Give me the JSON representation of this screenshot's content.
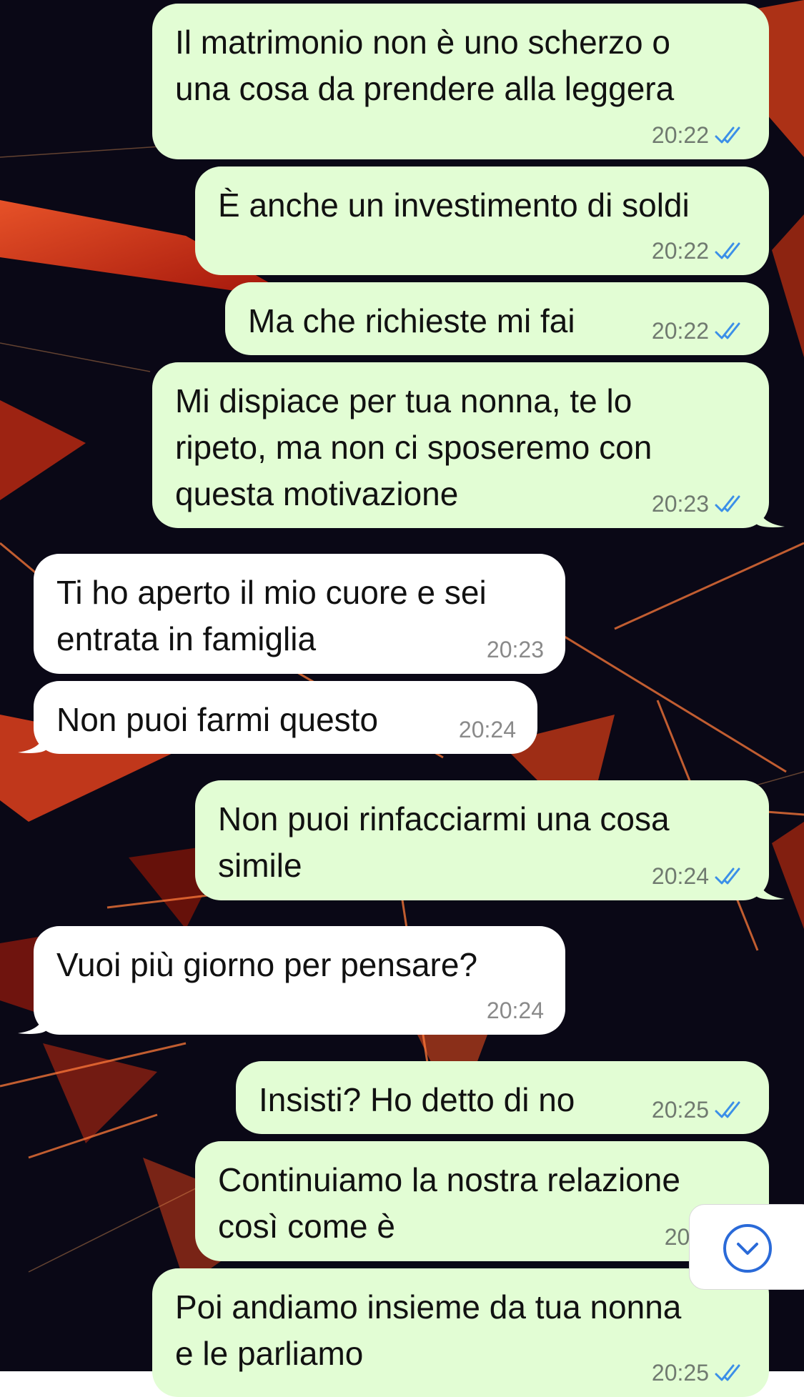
{
  "chat": {
    "messages": [
      {
        "dir": "out",
        "text": "Il matrimonio non è uno scherzo o\nuna cosa da prendere alla leggera",
        "time": "20:22",
        "status": "read"
      },
      {
        "dir": "out",
        "text": "È anche un investimento di soldi",
        "time": "20:22",
        "status": "read"
      },
      {
        "dir": "out",
        "text": "Ma che richieste mi fai",
        "time": "20:22",
        "status": "read"
      },
      {
        "dir": "out",
        "text": "Mi dispiace per tua nonna, te lo\nripeto, ma non ci sposeremo con\nquesta motivazione",
        "time": "20:23",
        "status": "read"
      },
      {
        "dir": "in",
        "text": "Ti ho aperto il mio cuore e sei\nentrata in famiglia",
        "time": "20:23"
      },
      {
        "dir": "in",
        "text": "Non puoi farmi questo",
        "time": "20:24"
      },
      {
        "dir": "out",
        "text": "Non puoi rinfacciarmi una cosa\nsimile",
        "time": "20:24",
        "status": "read"
      },
      {
        "dir": "in",
        "text": "Vuoi più giorno per pensare?",
        "time": "20:24"
      },
      {
        "dir": "out",
        "text": "Insisti? Ho detto di no",
        "time": "20:25",
        "status": "read"
      },
      {
        "dir": "out",
        "text": "Continuiamo la nostra relazione\ncosì come è",
        "time": "20:2",
        "status": "read"
      },
      {
        "dir": "out",
        "text": "Poi andiamo insieme da tua nonna\ne le parliamo",
        "time": "20:25",
        "status": "read"
      }
    ]
  },
  "scroll_button": {
    "icon": "chevron-down-circle-icon"
  },
  "colors": {
    "outgoing_bubble": "#e2fdd4",
    "incoming_bubble": "#ffffff",
    "read_ticks": "#3b8fe8",
    "time": "#707a70"
  }
}
